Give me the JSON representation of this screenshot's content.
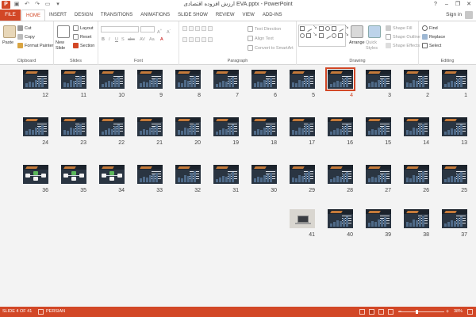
{
  "window": {
    "title": "EVA.pptx - PowerPoint",
    "title_rtl": "ارزش افزوده اقتصادی",
    "minimize": "–",
    "restore": "❐",
    "close": "✕",
    "help": "?"
  },
  "qat": [
    {
      "name": "save-icon",
      "glyph": "▣"
    },
    {
      "name": "undo-icon",
      "glyph": "↶"
    },
    {
      "name": "redo-icon",
      "glyph": "↷"
    },
    {
      "name": "start-slideshow-icon",
      "glyph": "▭"
    },
    {
      "name": "customize-qat-icon",
      "glyph": "▾"
    }
  ],
  "tabs": {
    "file": "FILE",
    "items": [
      "HOME",
      "INSERT",
      "DESIGN",
      "TRANSITIONS",
      "ANIMATIONS",
      "SLIDE SHOW",
      "REVIEW",
      "VIEW",
      "ADD-INS"
    ],
    "active": "HOME",
    "sign_in": "Sign in"
  },
  "ribbon": {
    "clipboard": {
      "label": "Clipboard",
      "paste": "Paste",
      "cut": "Cut",
      "copy": "Copy",
      "format_painter": "Format Painter"
    },
    "slides": {
      "label": "Slides",
      "new_slide": "New Slide",
      "layout": "Layout",
      "reset": "Reset",
      "section": "Section"
    },
    "font": {
      "label": "Font",
      "font_name": "",
      "font_size": "",
      "bold": "B",
      "italic": "I",
      "underline": "U",
      "strike": "S",
      "shadow": "abc",
      "spacing": "AV",
      "change_case": "Aa",
      "font_color": "A"
    },
    "paragraph": {
      "label": "Paragraph",
      "text_direction": "Text Direction",
      "align_text": "Align Text",
      "convert_smartart": "Convert to SmartArt"
    },
    "drawing": {
      "label": "Drawing",
      "arrange": "Arrange",
      "quick_styles": "Quick Styles",
      "shape_fill": "Shape Fill",
      "shape_outline": "Shape Outline",
      "shape_effects": "Shape Effects"
    },
    "editing": {
      "label": "Editing",
      "find": "Find",
      "replace": "Replace",
      "select": "Select"
    }
  },
  "slides": {
    "total": 41,
    "selected": "4",
    "rows": [
      [
        "12",
        "11",
        "10",
        "9",
        "8",
        "7",
        "6",
        "5",
        "4",
        "3",
        "2",
        "1"
      ],
      [
        "24",
        "23",
        "22",
        "21",
        "20",
        "19",
        "18",
        "17",
        "16",
        "15",
        "14",
        "13"
      ],
      [
        "36",
        "35",
        "34",
        "33",
        "32",
        "31",
        "30",
        "29",
        "28",
        "27",
        "26",
        "25"
      ],
      [
        "41",
        "40",
        "39",
        "38",
        "37"
      ]
    ],
    "photo_slide": "41",
    "diagram_slides": [
      "36",
      "35",
      "34"
    ]
  },
  "status": {
    "slide_info": "SLIDE 4 OF 41",
    "language": "PERSIAN",
    "zoom_minus": "−",
    "zoom_plus": "+",
    "zoom_percent": "38%",
    "zoom_level": 0.38
  },
  "colors": {
    "accent": "#d24726",
    "slide_bg": "#2a3542",
    "slide_stripe": "#c47a3a"
  }
}
